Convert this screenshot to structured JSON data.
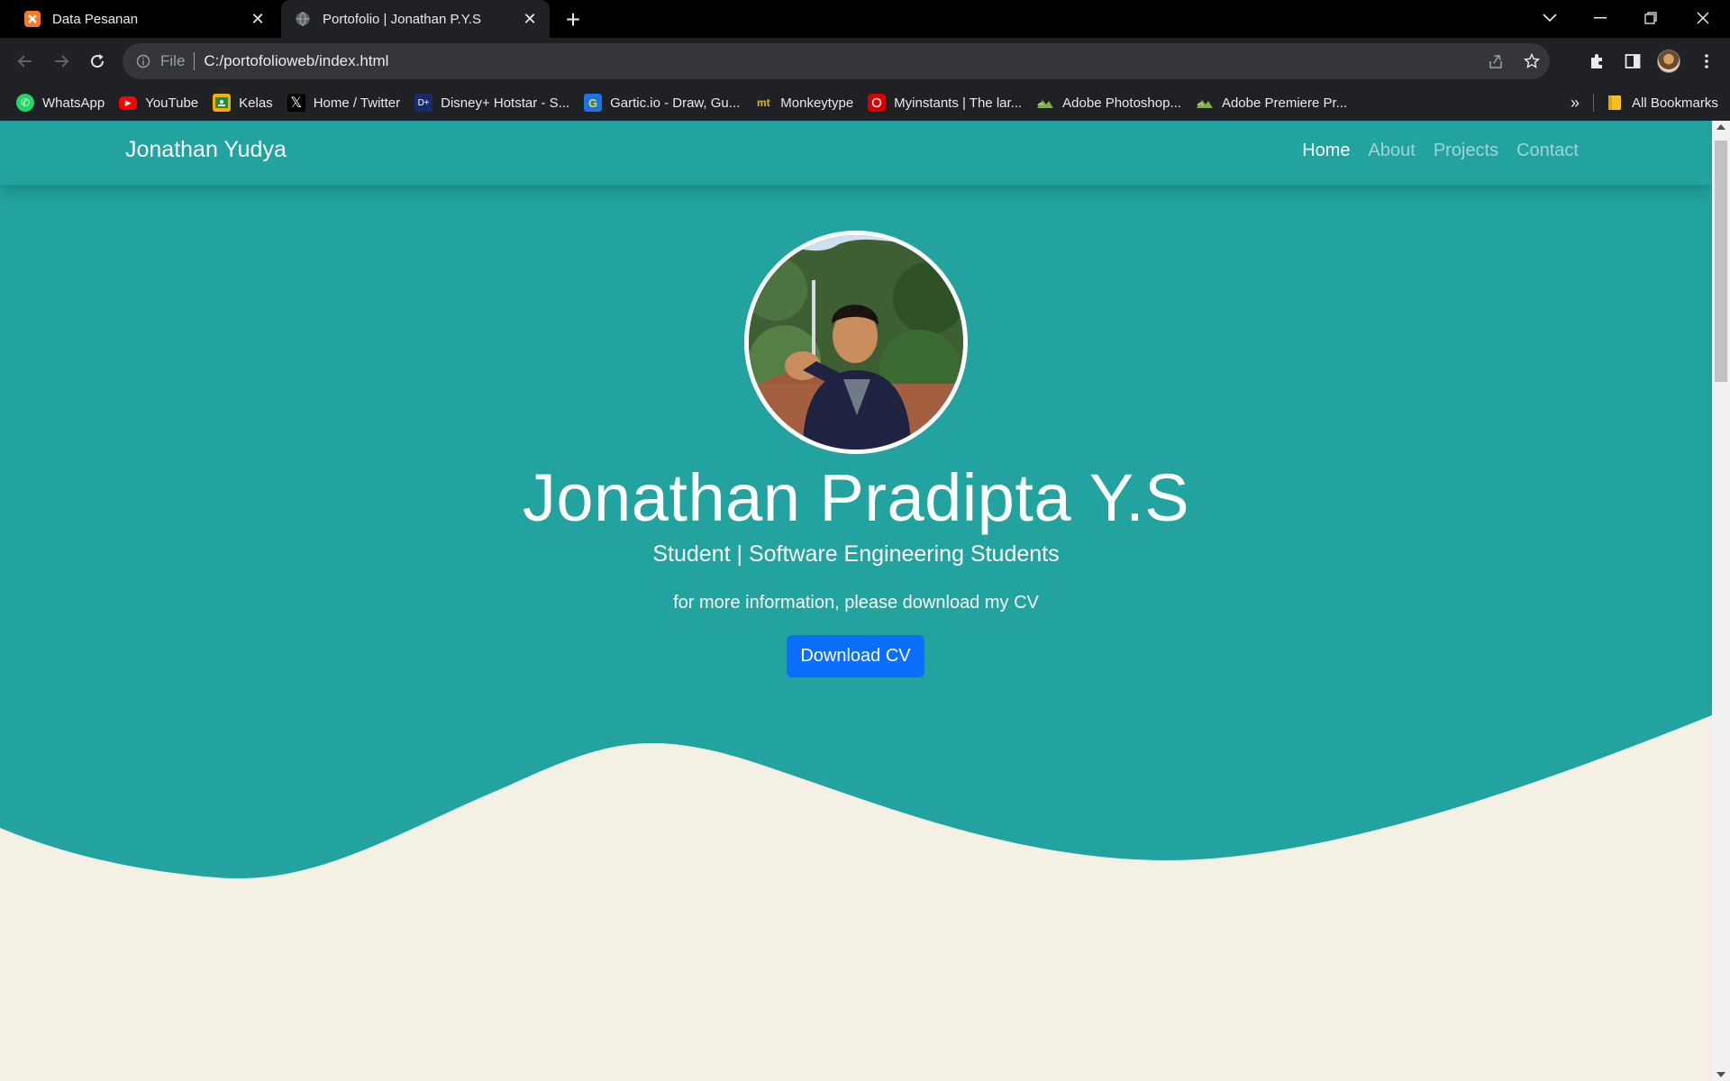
{
  "browser": {
    "tabs": [
      {
        "title": "Data Pesanan",
        "favicon": "xampp-icon"
      },
      {
        "title": "Portofolio | Jonathan P.Y.S",
        "favicon": "globe-icon"
      }
    ],
    "address": {
      "scheme": "File",
      "url": "C:/portofolioweb/index.html"
    },
    "bookmarks": [
      {
        "label": "WhatsApp",
        "icon": "whatsapp-icon",
        "color": "#25d366"
      },
      {
        "label": "YouTube",
        "icon": "youtube-icon",
        "color": "#ff0000"
      },
      {
        "label": "Kelas",
        "icon": "classroom-icon",
        "color": "#f9ab00"
      },
      {
        "label": "Home / Twitter",
        "icon": "x-icon",
        "color": "#000000"
      },
      {
        "label": "Disney+ Hotstar - S...",
        "icon": "hotstar-icon",
        "color": "#1a2b6d"
      },
      {
        "label": "Gartic.io - Draw, Gu...",
        "icon": "gartic-icon",
        "color": "#1a73e8"
      },
      {
        "label": "Monkeytype",
        "icon": "monkeytype-icon",
        "color": "#e2b714"
      },
      {
        "label": "Myinstants | The lar...",
        "icon": "myinstants-icon",
        "color": "#d60000"
      },
      {
        "label": "Adobe Photoshop...",
        "icon": "link-icon",
        "color": "#7cb342"
      },
      {
        "label": "Adobe Premiere Pr...",
        "icon": "link-icon",
        "color": "#7cb342"
      }
    ],
    "all_bookmarks": "All Bookmarks"
  },
  "site": {
    "brand": "Jonathan Yudya",
    "nav": [
      "Home",
      "About",
      "Projects",
      "Contact"
    ],
    "hero": {
      "name": "Jonathan Pradipta Y.S",
      "subtitle": "Student | Software Engineering Students",
      "info": "for more information, please download my CV",
      "button": "Download CV"
    },
    "colors": {
      "primary": "#22a39f",
      "background": "#f4f0e4",
      "button": "#0d6efd"
    }
  }
}
